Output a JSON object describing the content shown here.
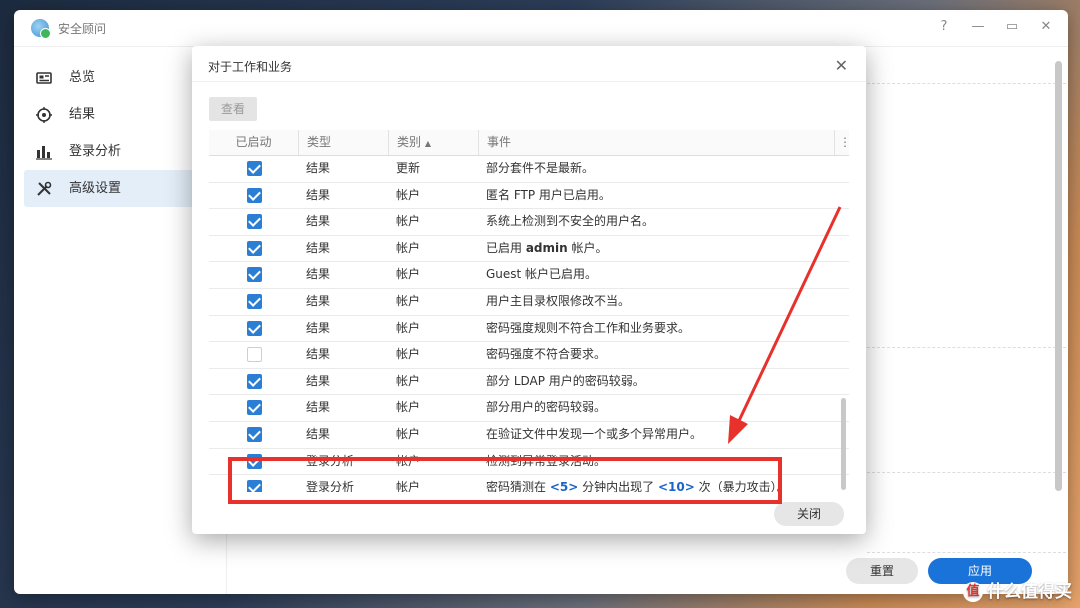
{
  "window": {
    "title": "安全顾问",
    "buttons": [
      "?",
      "—",
      "▭",
      "✕"
    ]
  },
  "sidebar": {
    "items": [
      {
        "label": "总览",
        "icon": "overview-icon",
        "active": false
      },
      {
        "label": "结果",
        "icon": "target-icon",
        "active": false
      },
      {
        "label": "登录分析",
        "icon": "bar-chart-icon",
        "active": false
      },
      {
        "label": "高级设置",
        "icon": "tools-icon",
        "active": true
      }
    ]
  },
  "footer": {
    "reset_label": "重置",
    "apply_label": "应用"
  },
  "dialog": {
    "title": "对于工作和业务",
    "view_label": "查看",
    "columns": [
      "已启动",
      "类型",
      "类别",
      "事件"
    ],
    "sort_indicator": "▲",
    "column_menu": "⋮",
    "close_label": "关闭",
    "rows": [
      {
        "enabled": true,
        "type": "结果",
        "category": "更新",
        "event": "部分套件不是最新。"
      },
      {
        "enabled": true,
        "type": "结果",
        "category": "帐户",
        "event": "匿名 FTP 用户已启用。"
      },
      {
        "enabled": true,
        "type": "结果",
        "category": "帐户",
        "event": "系统上检测到不安全的用户名。"
      },
      {
        "enabled": true,
        "type": "结果",
        "category": "帐户",
        "event_pre": "已启用 ",
        "event_bold": "admin",
        "event_post": " 帐户。"
      },
      {
        "enabled": true,
        "type": "结果",
        "category": "帐户",
        "event": "Guest 帐户已启用。"
      },
      {
        "enabled": true,
        "type": "结果",
        "category": "帐户",
        "event": "用户主目录权限修改不当。"
      },
      {
        "enabled": true,
        "type": "结果",
        "category": "帐户",
        "event": "密码强度规则不符合工作和业务要求。"
      },
      {
        "enabled": false,
        "type": "结果",
        "category": "帐户",
        "event": "密码强度不符合要求。"
      },
      {
        "enabled": true,
        "type": "结果",
        "category": "帐户",
        "event": "部分 LDAP 用户的密码较弱。"
      },
      {
        "enabled": true,
        "type": "结果",
        "category": "帐户",
        "event": "部分用户的密码较弱。"
      },
      {
        "enabled": true,
        "type": "结果",
        "category": "帐户",
        "event": "在验证文件中发现一个或多个异常用户。"
      },
      {
        "enabled": true,
        "type": "登录分析",
        "category": "帐户",
        "event": "检测到异常登录活动。"
      },
      {
        "enabled": true,
        "type": "登录分析",
        "category": "帐户",
        "event_a": "密码猜测在 ",
        "link1": "<5>",
        "event_b": " 分钟内出现了 ",
        "link2": "<10>",
        "event_c": " 次（暴力攻击）。"
      }
    ]
  },
  "annotation": {
    "color": "#e8312b"
  },
  "watermark": {
    "icon_char": "值",
    "text": "什么值得买"
  }
}
